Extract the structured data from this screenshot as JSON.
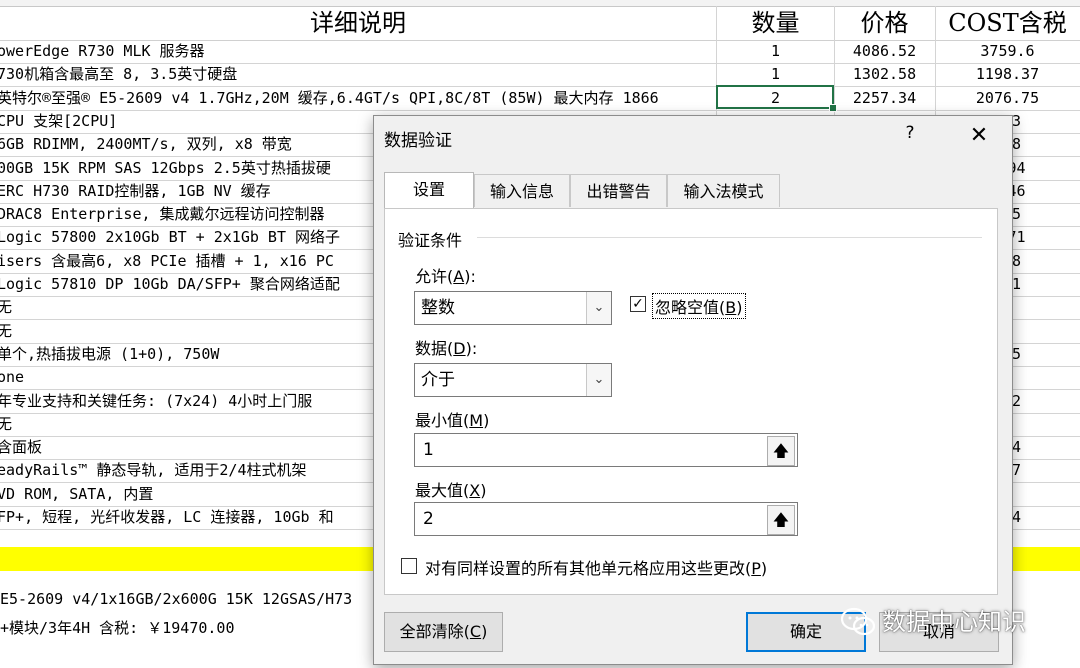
{
  "sheet": {
    "headers": {
      "desc": "详细说明",
      "qty": "数量",
      "price": "价格",
      "cost": "COST含税"
    },
    "rows": [
      {
        "desc": "owerEdge R730 MLK 服务器",
        "qty": "1",
        "price": "4086.52",
        "cost": "3759.6"
      },
      {
        "desc": "730机箱含最高至 8, 3.5英寸硬盘",
        "qty": "1",
        "price": "1302.58",
        "cost": "1198.37"
      },
      {
        "desc": "英特尔®至强® E5-2609 v4 1.7GHz,20M 缓存,6.4GT/s QPI,8C/8T (85W) 最大内存 1866",
        "qty": "2",
        "price": "2257.34",
        "cost": "2076.75"
      },
      {
        "desc": " CPU 支架[2CPU]",
        "qty": "",
        "price": "",
        "cost": ".33"
      },
      {
        "desc": "6GB RDIMM, 2400MT/s, 双列, x8 带宽",
        "qty": "",
        "price": "",
        "cost": ".08"
      },
      {
        "desc": "00GB 15K RPM SAS 12Gbps 2.5英寸热插拔硬",
        "qty": "",
        "price": "",
        "cost": "5.94"
      },
      {
        "desc": "ERC H730 RAID控制器, 1GB NV 缓存",
        "qty": "",
        "price": "",
        "cost": "9.46"
      },
      {
        "desc": "DRAC8 Enterprise, 集成戴尔远程访问控制器",
        "qty": "",
        "price": "",
        "cost": ".55"
      },
      {
        "desc": "Logic 57800 2x10Gb BT + 2x1Gb BT 网络子",
        "qty": "",
        "price": "",
        "cost": "7.71"
      },
      {
        "desc": "isers 含最高6, x8 PCIe 插槽 + 1, x16 PC",
        "qty": "",
        "price": "",
        "cost": ".18"
      },
      {
        "desc": "Logic 57810 DP 10Gb DA/SFP+ 聚合网络适配",
        "qty": "",
        "price": "",
        "cost": ".01"
      },
      {
        "desc": "无",
        "qty": "",
        "price": "",
        "cost": "0"
      },
      {
        "desc": "无",
        "qty": "",
        "price": "",
        "cost": "0"
      },
      {
        "desc": "单个,热插拔电源 (1+0), 750W",
        "qty": "",
        "price": "",
        "cost": ".85"
      },
      {
        "desc": "one",
        "qty": "",
        "price": "",
        "cost": "0"
      },
      {
        "desc": "年专业支持和关键任务: (7x24) 4小时上门服",
        "qty": "",
        "price": "",
        "cost": ".62"
      },
      {
        "desc": "无",
        "qty": "",
        "price": "",
        "cost": "0"
      },
      {
        "desc": "含面板",
        "qty": "",
        "price": "",
        "cost": ".54"
      },
      {
        "desc": "eadyRails™ 静态导轨, 适用于2/4柱式机架",
        "qty": "",
        "price": "",
        "cost": ".27"
      },
      {
        "desc": "VD ROM, SATA, 内置",
        "qty": "",
        "price": "",
        "cost": "1"
      },
      {
        "desc": "FP+, 短程, 光纤收发器, LC 连接器, 10Gb 和",
        "qty": "",
        "price": "",
        "cost": ".84"
      }
    ],
    "summary_line1": "E5-2609 v4/1x16GB/2x600G 15K 12GSAS/H73",
    "summary_line2": "+模块/3年4H      含税: ￥19470.00",
    "colors": {
      "selection": "#217346",
      "highlight_row": "#ffff00",
      "grid": "#d4d4d4"
    }
  },
  "dialog": {
    "title": "数据验证",
    "help_label": "?",
    "close_label": "✕",
    "tabs": [
      "设置",
      "输入信息",
      "出错警告",
      "输入法模式"
    ],
    "active_tab": "设置",
    "group_label": "验证条件",
    "allow_label": "允许",
    "allow_key": "A",
    "allow_value": "整数",
    "ignore_blank_label": "忽略空值",
    "ignore_blank_key": "B",
    "ignore_blank_checked": true,
    "data_label": "数据",
    "data_key": "D",
    "data_value": "介于",
    "min_label": "最小值",
    "min_key": "M",
    "min_value": "1",
    "max_label": "最大值",
    "max_key": "X",
    "max_value": "2",
    "apply_all_label": "对有同样设置的所有其他单元格应用这些更改",
    "apply_all_key": "P",
    "apply_all_checked": false,
    "clear_all_label": "全部清除",
    "clear_all_key": "C",
    "ok_label": "确定",
    "cancel_label": "取消",
    "icons": {
      "dropdown": "chevron-down-icon",
      "range_picker": "collapse-dialog-icon",
      "check": "checkmark-icon",
      "close": "close-icon"
    }
  },
  "watermark": {
    "text": "数据中心知识",
    "icon": "wechat-icon"
  }
}
